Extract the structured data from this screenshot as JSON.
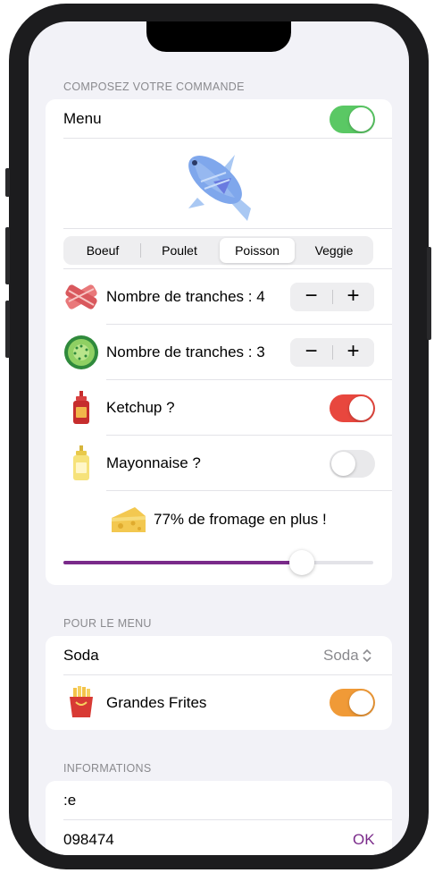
{
  "order": {
    "section_title": "COMPOSEZ VOTRE COMMANDE",
    "menu_label": "Menu",
    "menu_on": true,
    "segments": [
      "Boeuf",
      "Poulet",
      "Poisson",
      "Veggie"
    ],
    "selected_segment": "Poisson",
    "bacon_slices_label": "Nombre de tranches : 4",
    "cucumber_slices_label": "Nombre de tranches : 3",
    "stepper_minus": "−",
    "stepper_plus": "+",
    "ketchup_label": "Ketchup ?",
    "ketchup_on": true,
    "mayo_label": "Mayonnaise ?",
    "mayo_on": false,
    "cheese_label": "77% de fromage en plus !",
    "cheese_percent": 77
  },
  "menu_section": {
    "section_title": "POUR LE MENU",
    "soda_label": "Soda",
    "soda_value": "Soda",
    "fries_label": "Grandes Frites",
    "fries_on": true
  },
  "info": {
    "section_title": "INFORMATIONS",
    "name_value": ":e",
    "phone_value": "098474",
    "ok_label": "OK"
  },
  "colors": {
    "toggle_green": "#5ac864",
    "toggle_red": "#e8473e",
    "toggle_orange": "#f09a37",
    "slider_fill": "#7a2a8a",
    "ok_purple": "#7a2a8a"
  }
}
